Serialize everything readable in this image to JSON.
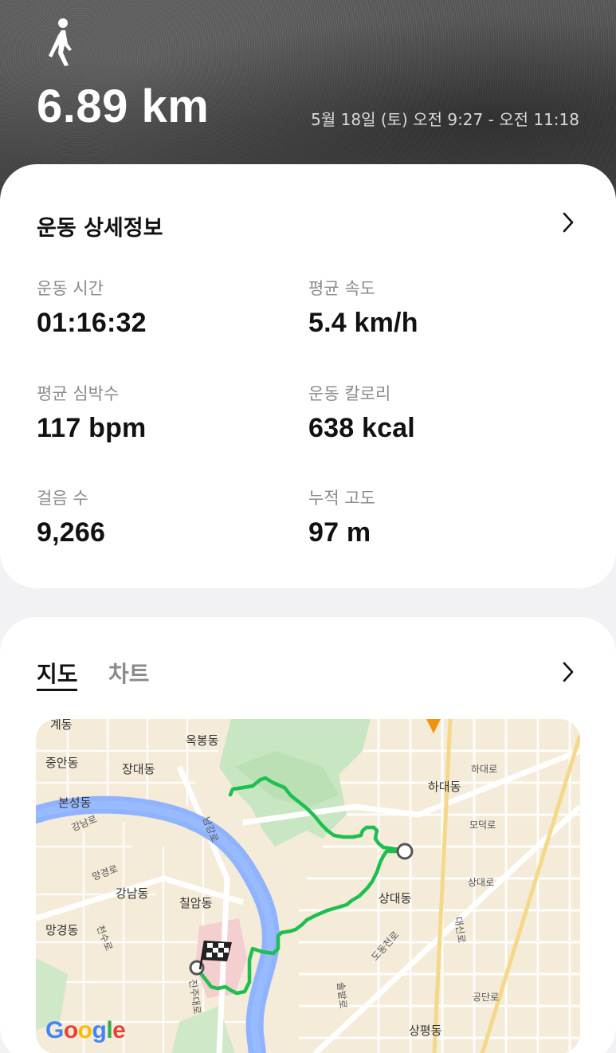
{
  "header": {
    "activity_icon": "walking-person-icon",
    "distance": "6.89 km",
    "datetime": "5월 18일 (토) 오전 9:27 - 오전 11:18"
  },
  "details": {
    "title": "운동 상세정보",
    "stats": [
      {
        "label": "운동 시간",
        "value": "01:16:32"
      },
      {
        "label": "평균 속도",
        "value": "5.4 km/h"
      },
      {
        "label": "평균 심박수",
        "value": "117 bpm"
      },
      {
        "label": "운동 칼로리",
        "value": "638 kcal"
      },
      {
        "label": "걸음 수",
        "value": "9,266"
      },
      {
        "label": "누적 고도",
        "value": "97 m"
      }
    ]
  },
  "map_section": {
    "tabs": [
      {
        "label": "지도",
        "selected": true
      },
      {
        "label": "차트",
        "selected": false
      }
    ],
    "map_labels": {
      "l1": "옥봉동",
      "l2": "중안동",
      "l3": "장대동",
      "l4": "하대로",
      "l5": "하대동",
      "l6": "본성동",
      "l7": "남강로",
      "l8": "강남로",
      "l9": "모덕로",
      "l10": "망경로",
      "l11": "강남동",
      "l12": "상대로",
      "l13": "칠암동",
      "l14": "상대동",
      "l15": "망경동",
      "l16": "천수로",
      "l17": "도동천로",
      "l18": "대신로",
      "l19": "진주대로",
      "l20": "솔밭로",
      "l21": "공단로",
      "l22": "상평동",
      "l23": "계동"
    },
    "google": "Google",
    "route_color": "#1fbf4f",
    "river_color": "#8fb3ff"
  },
  "colors": {
    "background": "#f2f2f4",
    "card": "#ffffff",
    "text_primary": "#111111",
    "text_secondary": "#8a8a8a"
  }
}
